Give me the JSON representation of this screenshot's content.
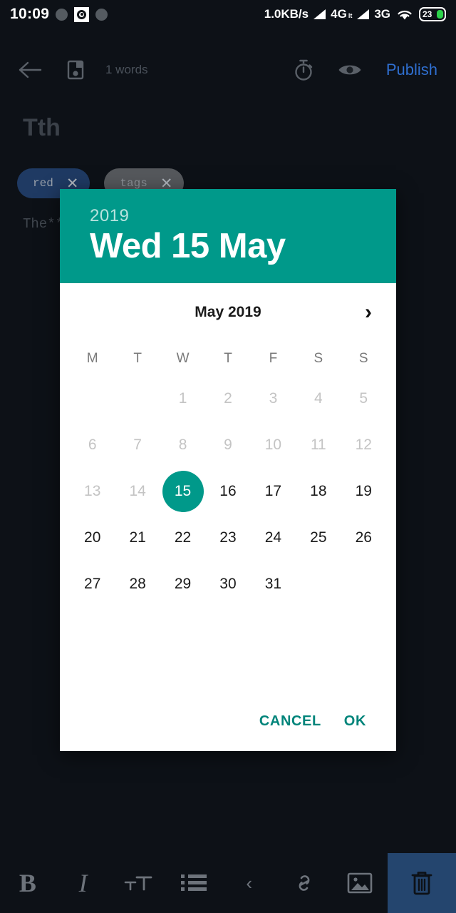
{
  "statusbar": {
    "time": "10:09",
    "icons": [
      "circle-icon",
      "screen-record-icon",
      "circle-icon"
    ],
    "network_speed": "1.0KB/s",
    "sim1_label": "4G",
    "sim1_sub": "lt",
    "sim2_label": "3G",
    "wifi_icon": "wifi-icon",
    "battery_level": "23"
  },
  "toolbar": {
    "back_icon": "back-arrow-icon",
    "save_icon": "save-icon",
    "word_count": "1 words",
    "timer_icon": "stopwatch-icon",
    "preview_icon": "eye-icon",
    "publish_label": "Publish",
    "publish_color": "#2f6fd0"
  },
  "document": {
    "title": "Tth",
    "tags": [
      {
        "label": "red",
        "color": "#1f3a63",
        "remove_icon": "close-icon"
      },
      {
        "label": "tags",
        "color": "#55585c",
        "remove_icon": "close-icon"
      }
    ],
    "body": "The***"
  },
  "dialog": {
    "accent_color": "#00998a",
    "header": {
      "year": "2019",
      "date": "Wed 15 May"
    },
    "month_label": "May 2019",
    "next_month_icon": "chevron-right-icon",
    "weekdays": [
      "M",
      "T",
      "W",
      "T",
      "F",
      "S",
      "S"
    ],
    "weeks": [
      [
        {
          "day": "",
          "state": "empty"
        },
        {
          "day": "",
          "state": "empty"
        },
        {
          "day": "1",
          "state": "disabled"
        },
        {
          "day": "2",
          "state": "disabled"
        },
        {
          "day": "3",
          "state": "disabled"
        },
        {
          "day": "4",
          "state": "disabled"
        },
        {
          "day": "5",
          "state": "disabled"
        }
      ],
      [
        {
          "day": "6",
          "state": "disabled"
        },
        {
          "day": "7",
          "state": "disabled"
        },
        {
          "day": "8",
          "state": "disabled"
        },
        {
          "day": "9",
          "state": "disabled"
        },
        {
          "day": "10",
          "state": "disabled"
        },
        {
          "day": "11",
          "state": "disabled"
        },
        {
          "day": "12",
          "state": "disabled"
        }
      ],
      [
        {
          "day": "13",
          "state": "disabled"
        },
        {
          "day": "14",
          "state": "disabled"
        },
        {
          "day": "15",
          "state": "selected"
        },
        {
          "day": "16",
          "state": "enabled"
        },
        {
          "day": "17",
          "state": "enabled"
        },
        {
          "day": "18",
          "state": "enabled"
        },
        {
          "day": "19",
          "state": "enabled"
        }
      ],
      [
        {
          "day": "20",
          "state": "enabled"
        },
        {
          "day": "21",
          "state": "enabled"
        },
        {
          "day": "22",
          "state": "enabled"
        },
        {
          "day": "23",
          "state": "enabled"
        },
        {
          "day": "24",
          "state": "enabled"
        },
        {
          "day": "25",
          "state": "enabled"
        },
        {
          "day": "26",
          "state": "enabled"
        }
      ],
      [
        {
          "day": "27",
          "state": "enabled"
        },
        {
          "day": "28",
          "state": "enabled"
        },
        {
          "day": "29",
          "state": "enabled"
        },
        {
          "day": "30",
          "state": "enabled"
        },
        {
          "day": "31",
          "state": "enabled"
        },
        {
          "day": "",
          "state": "empty"
        },
        {
          "day": "",
          "state": "empty"
        }
      ]
    ],
    "cancel_label": "CANCEL",
    "ok_label": "OK"
  },
  "bottombar": {
    "items": [
      {
        "name": "bold-icon",
        "glyph": "B"
      },
      {
        "name": "italic-icon",
        "glyph": "I"
      },
      {
        "name": "text-size-icon",
        "glyph": ""
      },
      {
        "name": "bullet-list-icon",
        "glyph": ""
      },
      {
        "name": "chevron-left-icon",
        "glyph": "‹"
      },
      {
        "name": "link-icon",
        "glyph": ""
      },
      {
        "name": "image-icon",
        "glyph": ""
      },
      {
        "name": "trash-icon",
        "glyph": ""
      }
    ],
    "trash_bg": "#24456e"
  }
}
